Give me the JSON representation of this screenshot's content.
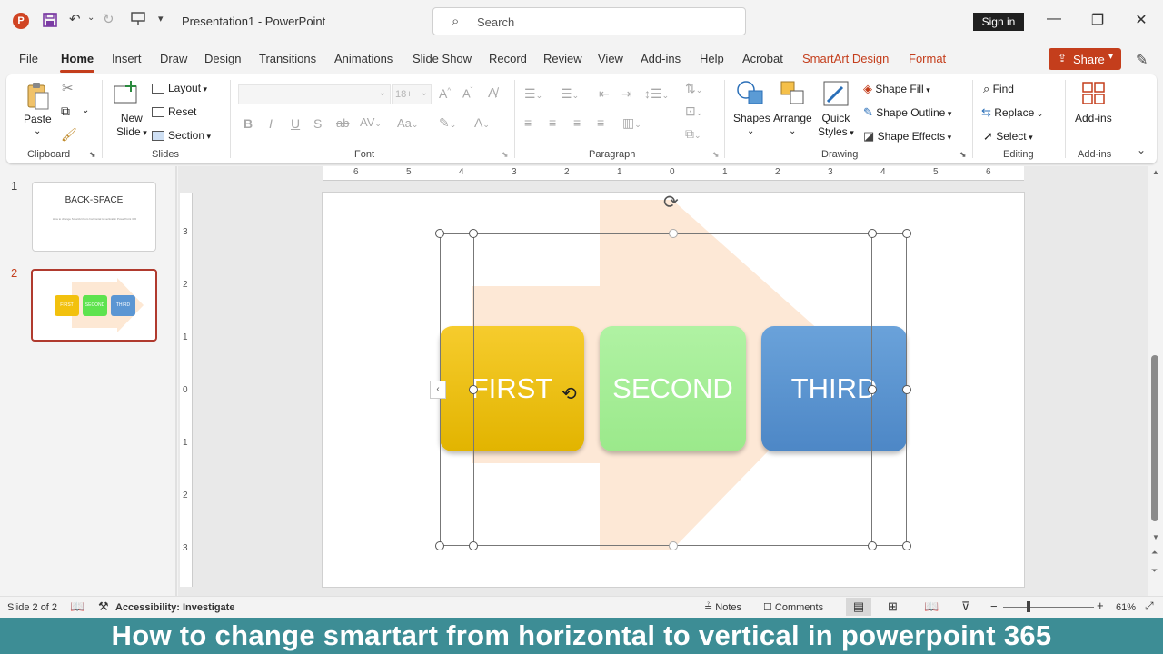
{
  "app": {
    "title": "Presentation1",
    "app_name": "PowerPoint",
    "search_placeholder": "Search",
    "sign_in": "Sign in",
    "share": "Share"
  },
  "tabs": [
    "File",
    "Home",
    "Insert",
    "Draw",
    "Design",
    "Transitions",
    "Animations",
    "Slide Show",
    "Record",
    "Review",
    "View",
    "Add-ins",
    "Help",
    "Acrobat",
    "SmartArt Design",
    "Format"
  ],
  "ribbon": {
    "clipboard": {
      "paste": "Paste",
      "label": "Clipboard"
    },
    "slides": {
      "new_slide_1": "New",
      "new_slide_2": "Slide",
      "layout": "Layout",
      "reset": "Reset",
      "section": "Section",
      "label": "Slides"
    },
    "font": {
      "size": "18+",
      "label": "Font"
    },
    "paragraph": {
      "label": "Paragraph"
    },
    "drawing": {
      "shapes": "Shapes",
      "arrange": "Arrange",
      "quick": "Quick",
      "styles": "Styles",
      "shape_fill": "Shape Fill",
      "shape_outline": "Shape Outline",
      "shape_effects": "Shape Effects",
      "label": "Drawing"
    },
    "editing": {
      "find": "Find",
      "replace": "Replace",
      "select": "Select",
      "label": "Editing"
    },
    "addins": {
      "addins": "Add-ins",
      "label": "Add-ins"
    }
  },
  "thumbnails": [
    {
      "number": "1",
      "title": "BACK-SPACE",
      "subtitle": "How to change SmartArt from horizontal to vertical in PowerPoint 365"
    },
    {
      "number": "2",
      "boxes": [
        "FIRST",
        "SECOND",
        "THIRD"
      ]
    }
  ],
  "slide": {
    "boxes": [
      {
        "label": "FIRST",
        "color": "#f2c10e"
      },
      {
        "label": "SECOND",
        "color": "#a8ef98"
      },
      {
        "label": "THIRD",
        "color": "#5b96d3"
      }
    ],
    "arrow_color": "#fde4cf"
  },
  "ruler": {
    "h_ticks": [
      "6",
      "5",
      "4",
      "3",
      "2",
      "1",
      "0",
      "1",
      "2",
      "3",
      "4",
      "5",
      "6"
    ],
    "v_ticks": [
      "3",
      "2",
      "1",
      "0",
      "1",
      "2",
      "3"
    ]
  },
  "status": {
    "slide_of": "Slide 2 of 2",
    "accessibility": "Accessibility: Investigate",
    "notes": "Notes",
    "comments": "Comments",
    "zoom": "61%"
  },
  "caption": "How to change smartart from horizontal to vertical in powerpoint 365"
}
